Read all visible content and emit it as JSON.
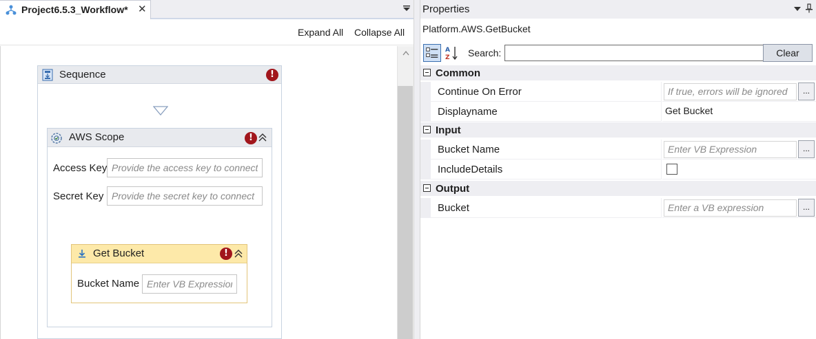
{
  "designer": {
    "tab_title": "Project6.5.3_Workflow*",
    "tab_close": "✕",
    "expand_all": "Expand All",
    "collapse_all": "Collapse All"
  },
  "sequence": {
    "title": "Sequence",
    "error_glyph": "!"
  },
  "aws_scope": {
    "title": "AWS Scope",
    "access_key_label": "Access Key",
    "access_key_placeholder": "Provide the access key to connect",
    "secret_key_label": "Secret Key",
    "secret_key_placeholder": "Provide the secret key to connect"
  },
  "get_bucket": {
    "title": "Get Bucket",
    "bucket_name_label": "Bucket Name",
    "bucket_name_placeholder": "Enter VB Expression"
  },
  "properties": {
    "title": "Properties",
    "activity_type": "Platform.AWS.GetBucket",
    "search_label": "Search:",
    "search_value": "",
    "clear_label": "Clear",
    "ellipsis": "...",
    "categories": {
      "common": "Common",
      "input": "Input",
      "output": "Output"
    },
    "rows": {
      "continue_on_error": {
        "name": "Continue On Error",
        "placeholder": "If true, errors will be ignored"
      },
      "displayname": {
        "name": "Displayname",
        "value": "Get Bucket"
      },
      "bucket_name": {
        "name": "Bucket Name",
        "placeholder": "Enter VB Expression"
      },
      "include_details": {
        "name": "IncludeDetails",
        "checked": false
      },
      "bucket": {
        "name": "Bucket",
        "placeholder": "Enter a VB expression"
      }
    }
  },
  "colors": {
    "error_red": "#a1161c",
    "get_bucket_header": "#fde9a9",
    "panel_header": "#eeeef2"
  }
}
